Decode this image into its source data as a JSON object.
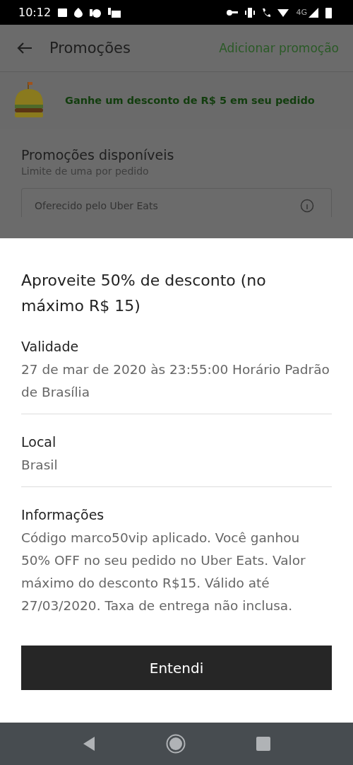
{
  "status_bar": {
    "time": "10:12",
    "network": "4G"
  },
  "header": {
    "title": "Promoções",
    "action": "Adicionar promoção"
  },
  "banner": {
    "text": "Ganhe um desconto de R$ 5 em seu pedido"
  },
  "available": {
    "title": "Promoções disponíveis",
    "subtitle": "Limite de uma por pedido",
    "card_label": "Oferecido pelo Uber Eats"
  },
  "sheet": {
    "title": "Aproveite 50% de desconto (no máximo R$ 15)",
    "sections": [
      {
        "heading": "Validade",
        "body": "27 de mar de 2020 às 23:55:00 Horário Padrão de Brasília"
      },
      {
        "heading": "Local",
        "body": "Brasil"
      },
      {
        "heading": "Informações",
        "body": "Código marco50vip aplicado. Você ganhou 50% OFF no seu pedido no Uber Eats. Valor máximo do desconto R$15. Válido até 27/03/2020. Taxa de entrega não inclusa."
      }
    ],
    "button": "Entendi"
  }
}
